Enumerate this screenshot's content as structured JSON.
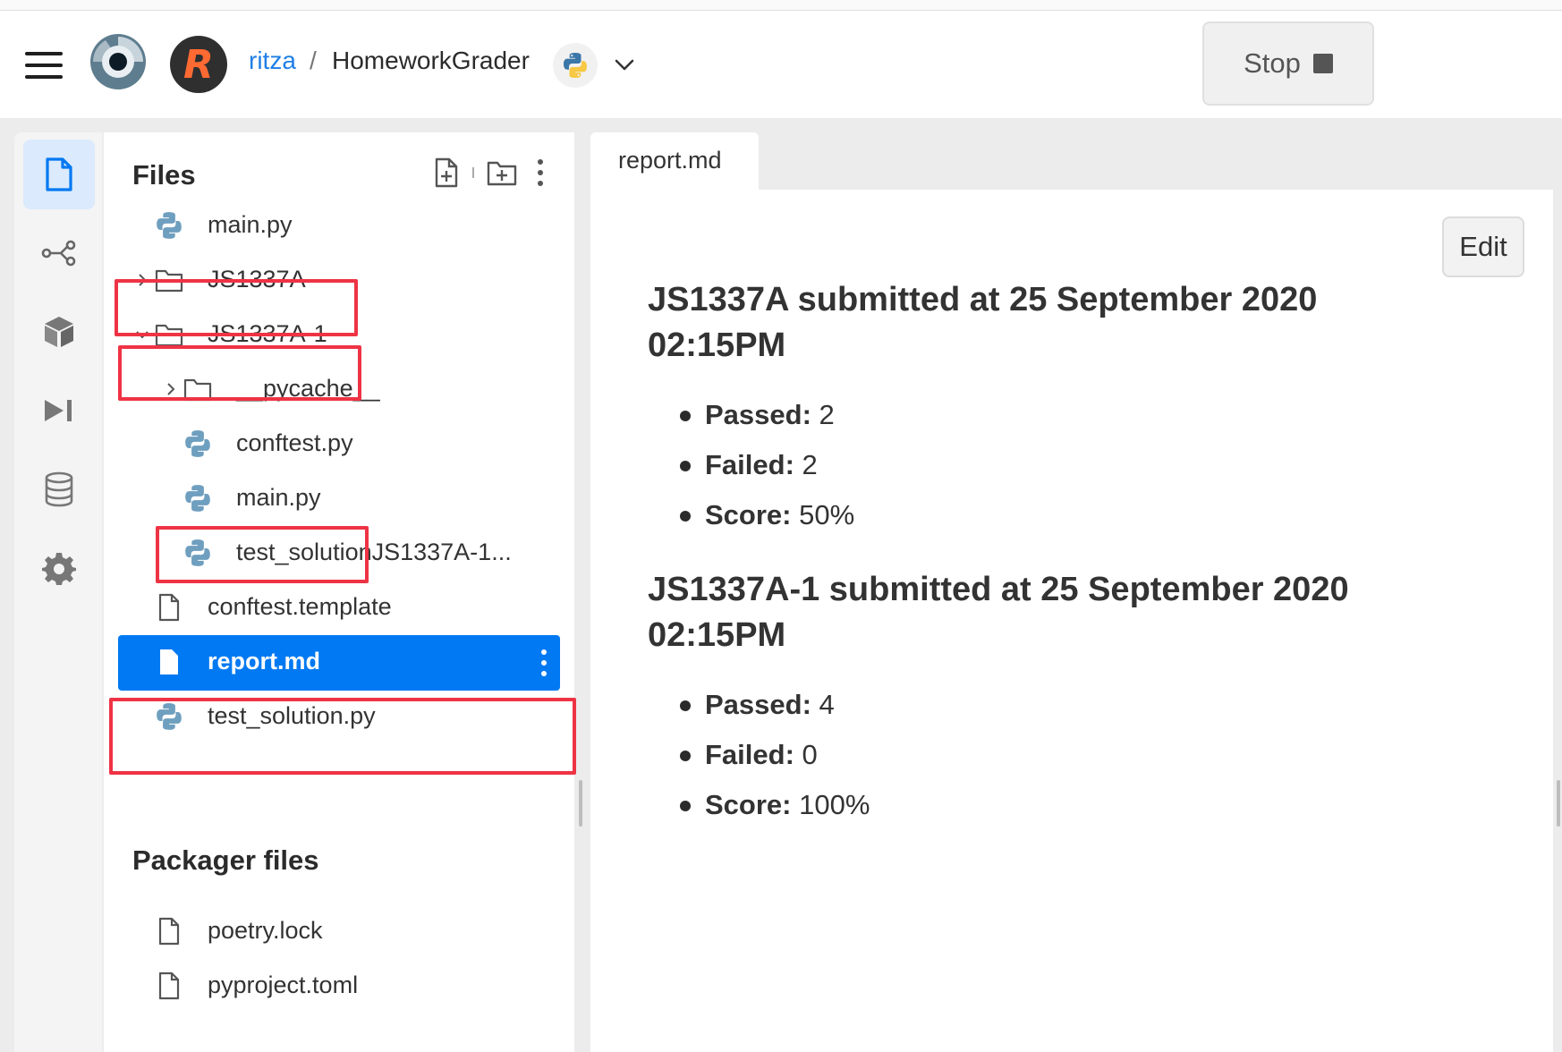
{
  "header": {
    "user": "ritza",
    "separator": "/",
    "repl_name": "HomeworkGrader",
    "stop_label": "Stop"
  },
  "rail": {
    "items": [
      "files-icon",
      "version-control-icon",
      "packages-icon",
      "debugger-icon",
      "database-icon",
      "settings-icon"
    ]
  },
  "files": {
    "title": "Files",
    "tree": [
      {
        "label": "main.py",
        "type": "python"
      },
      {
        "label": "JS1337A",
        "type": "folder",
        "expanded": false
      },
      {
        "label": "JS1337A-1",
        "type": "folder",
        "expanded": true
      },
      {
        "label": "__pycache__",
        "type": "folder",
        "expanded": false
      },
      {
        "label": "conftest.py",
        "type": "python"
      },
      {
        "label": "main.py",
        "type": "python"
      },
      {
        "label": "test_solutionJS1337A-1...",
        "type": "python"
      },
      {
        "label": "conftest.template",
        "type": "file"
      },
      {
        "label": "report.md",
        "type": "file",
        "selected": true
      },
      {
        "label": "test_solution.py",
        "type": "python"
      }
    ],
    "packager_title": "Packager files",
    "packager": [
      {
        "label": "poetry.lock",
        "type": "file"
      },
      {
        "label": "pyproject.toml",
        "type": "file"
      }
    ]
  },
  "editor": {
    "tab": "report.md",
    "edit_label": "Edit",
    "sections": [
      {
        "heading": "JS1337A submitted at 25 September 2020 02:15PM",
        "items": [
          {
            "key": "Passed:",
            "value": " 2"
          },
          {
            "key": "Failed:",
            "value": " 2"
          },
          {
            "key": "Score:",
            "value": " 50%"
          }
        ]
      },
      {
        "heading": "JS1337A-1 submitted at 25 September 2020 02:15PM",
        "items": [
          {
            "key": "Passed:",
            "value": " 4"
          },
          {
            "key": "Failed:",
            "value": " 0"
          },
          {
            "key": "Score:",
            "value": " 100%"
          }
        ]
      }
    ]
  },
  "colors": {
    "accent": "#0079f2",
    "link": "#1f7fe6",
    "highlight": "#ee3344",
    "avatar_letter": "#ff6a33"
  }
}
